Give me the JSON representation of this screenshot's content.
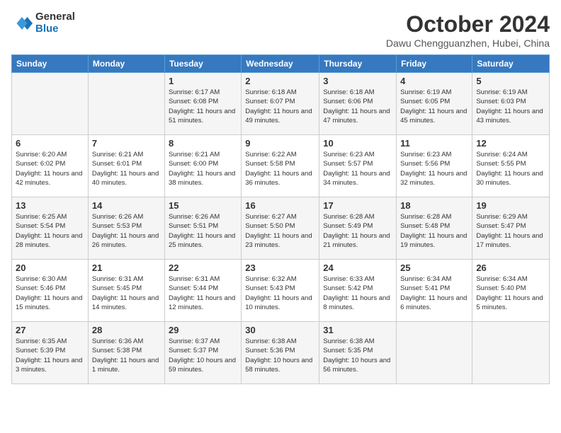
{
  "logo": {
    "general": "General",
    "blue": "Blue"
  },
  "title": "October 2024",
  "subtitle": "Dawu Chengguanzhen, Hubei, China",
  "weekdays": [
    "Sunday",
    "Monday",
    "Tuesday",
    "Wednesday",
    "Thursday",
    "Friday",
    "Saturday"
  ],
  "weeks": [
    [
      {
        "day": "",
        "detail": ""
      },
      {
        "day": "",
        "detail": ""
      },
      {
        "day": "1",
        "detail": "Sunrise: 6:17 AM\nSunset: 6:08 PM\nDaylight: 11 hours and 51 minutes."
      },
      {
        "day": "2",
        "detail": "Sunrise: 6:18 AM\nSunset: 6:07 PM\nDaylight: 11 hours and 49 minutes."
      },
      {
        "day": "3",
        "detail": "Sunrise: 6:18 AM\nSunset: 6:06 PM\nDaylight: 11 hours and 47 minutes."
      },
      {
        "day": "4",
        "detail": "Sunrise: 6:19 AM\nSunset: 6:05 PM\nDaylight: 11 hours and 45 minutes."
      },
      {
        "day": "5",
        "detail": "Sunrise: 6:19 AM\nSunset: 6:03 PM\nDaylight: 11 hours and 43 minutes."
      }
    ],
    [
      {
        "day": "6",
        "detail": "Sunrise: 6:20 AM\nSunset: 6:02 PM\nDaylight: 11 hours and 42 minutes."
      },
      {
        "day": "7",
        "detail": "Sunrise: 6:21 AM\nSunset: 6:01 PM\nDaylight: 11 hours and 40 minutes."
      },
      {
        "day": "8",
        "detail": "Sunrise: 6:21 AM\nSunset: 6:00 PM\nDaylight: 11 hours and 38 minutes."
      },
      {
        "day": "9",
        "detail": "Sunrise: 6:22 AM\nSunset: 5:58 PM\nDaylight: 11 hours and 36 minutes."
      },
      {
        "day": "10",
        "detail": "Sunrise: 6:23 AM\nSunset: 5:57 PM\nDaylight: 11 hours and 34 minutes."
      },
      {
        "day": "11",
        "detail": "Sunrise: 6:23 AM\nSunset: 5:56 PM\nDaylight: 11 hours and 32 minutes."
      },
      {
        "day": "12",
        "detail": "Sunrise: 6:24 AM\nSunset: 5:55 PM\nDaylight: 11 hours and 30 minutes."
      }
    ],
    [
      {
        "day": "13",
        "detail": "Sunrise: 6:25 AM\nSunset: 5:54 PM\nDaylight: 11 hours and 28 minutes."
      },
      {
        "day": "14",
        "detail": "Sunrise: 6:26 AM\nSunset: 5:53 PM\nDaylight: 11 hours and 26 minutes."
      },
      {
        "day": "15",
        "detail": "Sunrise: 6:26 AM\nSunset: 5:51 PM\nDaylight: 11 hours and 25 minutes."
      },
      {
        "day": "16",
        "detail": "Sunrise: 6:27 AM\nSunset: 5:50 PM\nDaylight: 11 hours and 23 minutes."
      },
      {
        "day": "17",
        "detail": "Sunrise: 6:28 AM\nSunset: 5:49 PM\nDaylight: 11 hours and 21 minutes."
      },
      {
        "day": "18",
        "detail": "Sunrise: 6:28 AM\nSunset: 5:48 PM\nDaylight: 11 hours and 19 minutes."
      },
      {
        "day": "19",
        "detail": "Sunrise: 6:29 AM\nSunset: 5:47 PM\nDaylight: 11 hours and 17 minutes."
      }
    ],
    [
      {
        "day": "20",
        "detail": "Sunrise: 6:30 AM\nSunset: 5:46 PM\nDaylight: 11 hours and 15 minutes."
      },
      {
        "day": "21",
        "detail": "Sunrise: 6:31 AM\nSunset: 5:45 PM\nDaylight: 11 hours and 14 minutes."
      },
      {
        "day": "22",
        "detail": "Sunrise: 6:31 AM\nSunset: 5:44 PM\nDaylight: 11 hours and 12 minutes."
      },
      {
        "day": "23",
        "detail": "Sunrise: 6:32 AM\nSunset: 5:43 PM\nDaylight: 11 hours and 10 minutes."
      },
      {
        "day": "24",
        "detail": "Sunrise: 6:33 AM\nSunset: 5:42 PM\nDaylight: 11 hours and 8 minutes."
      },
      {
        "day": "25",
        "detail": "Sunrise: 6:34 AM\nSunset: 5:41 PM\nDaylight: 11 hours and 6 minutes."
      },
      {
        "day": "26",
        "detail": "Sunrise: 6:34 AM\nSunset: 5:40 PM\nDaylight: 11 hours and 5 minutes."
      }
    ],
    [
      {
        "day": "27",
        "detail": "Sunrise: 6:35 AM\nSunset: 5:39 PM\nDaylight: 11 hours and 3 minutes."
      },
      {
        "day": "28",
        "detail": "Sunrise: 6:36 AM\nSunset: 5:38 PM\nDaylight: 11 hours and 1 minute."
      },
      {
        "day": "29",
        "detail": "Sunrise: 6:37 AM\nSunset: 5:37 PM\nDaylight: 10 hours and 59 minutes."
      },
      {
        "day": "30",
        "detail": "Sunrise: 6:38 AM\nSunset: 5:36 PM\nDaylight: 10 hours and 58 minutes."
      },
      {
        "day": "31",
        "detail": "Sunrise: 6:38 AM\nSunset: 5:35 PM\nDaylight: 10 hours and 56 minutes."
      },
      {
        "day": "",
        "detail": ""
      },
      {
        "day": "",
        "detail": ""
      }
    ]
  ]
}
